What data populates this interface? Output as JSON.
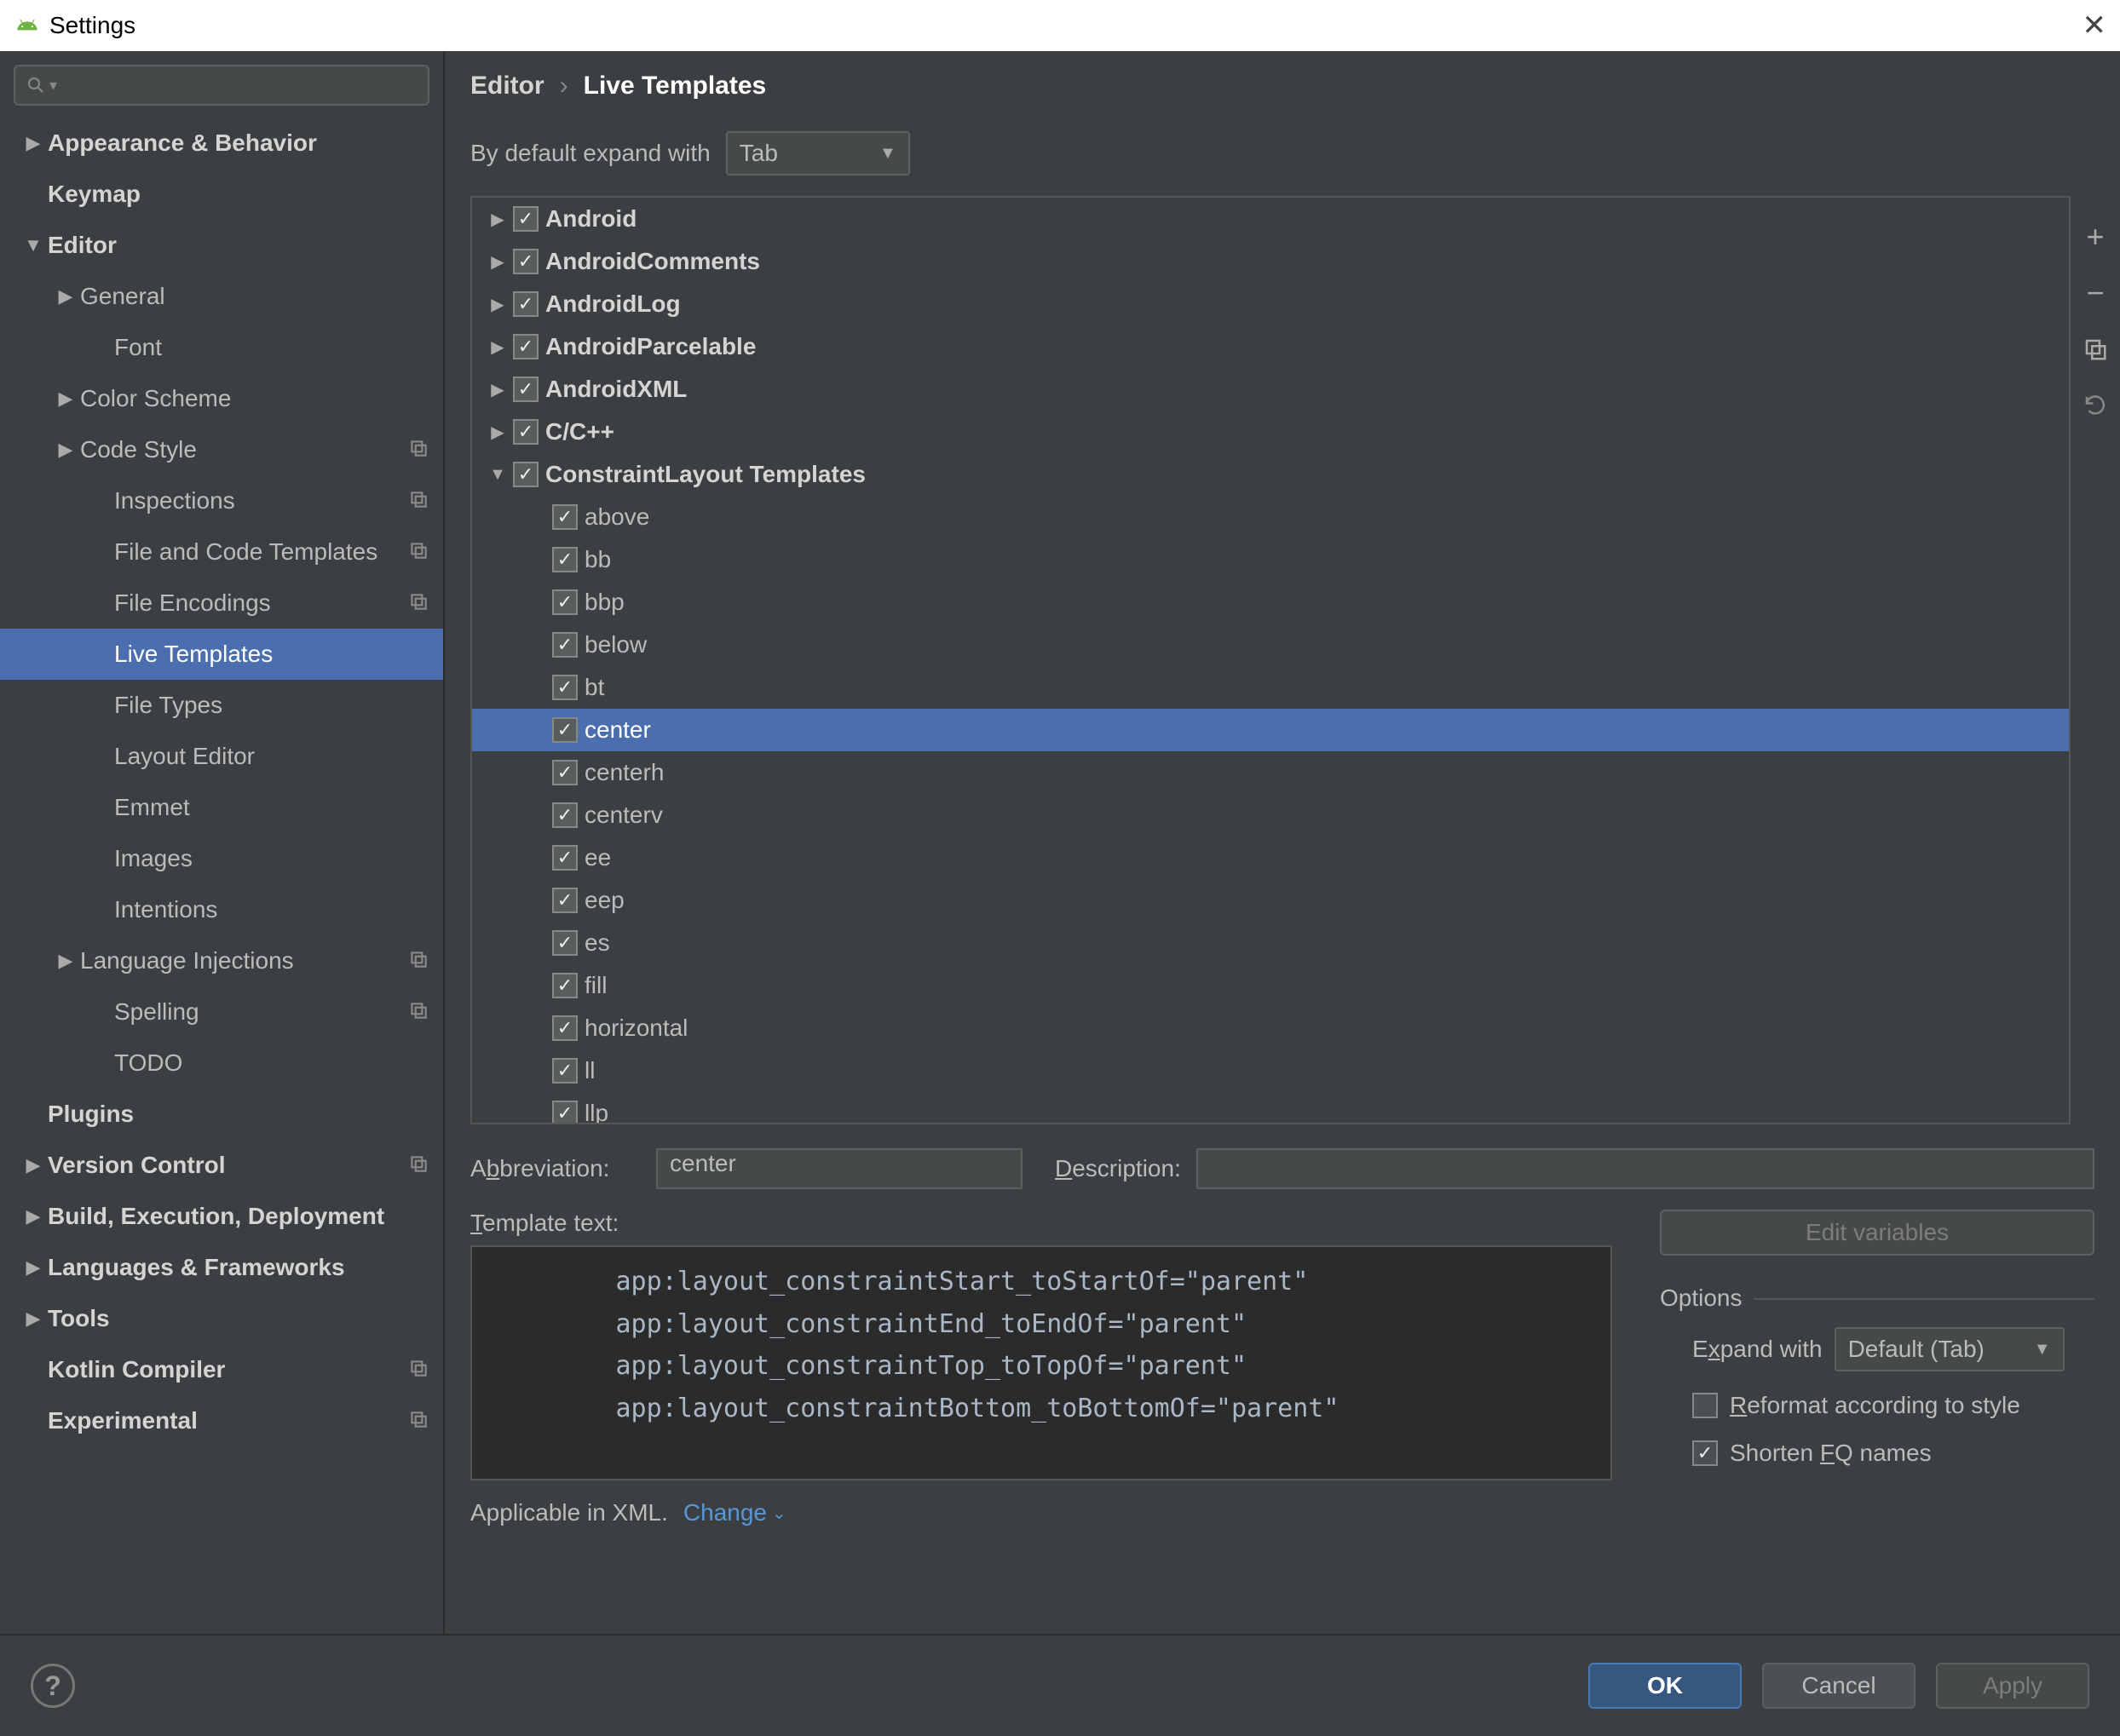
{
  "title": "Settings",
  "close_x": "✕",
  "searchPlaceholder": "",
  "sidebar": [
    {
      "arrow": "right",
      "label": "Appearance & Behavior",
      "indent": 1,
      "bold": true
    },
    {
      "arrow": "none",
      "label": "Keymap",
      "indent": 1,
      "bold": true
    },
    {
      "arrow": "down",
      "label": "Editor",
      "indent": 1,
      "bold": true
    },
    {
      "arrow": "right",
      "label": "General",
      "indent": 2
    },
    {
      "arrow": "none",
      "label": "Font",
      "indent": 3
    },
    {
      "arrow": "right",
      "label": "Color Scheme",
      "indent": 2
    },
    {
      "arrow": "right",
      "label": "Code Style",
      "indent": 2,
      "copy": true
    },
    {
      "arrow": "none",
      "label": "Inspections",
      "indent": 3,
      "copy": true
    },
    {
      "arrow": "none",
      "label": "File and Code Templates",
      "indent": 3,
      "copy": true
    },
    {
      "arrow": "none",
      "label": "File Encodings",
      "indent": 3,
      "copy": true
    },
    {
      "arrow": "none",
      "label": "Live Templates",
      "indent": 3,
      "selected": true
    },
    {
      "arrow": "none",
      "label": "File Types",
      "indent": 3
    },
    {
      "arrow": "none",
      "label": "Layout Editor",
      "indent": 3
    },
    {
      "arrow": "none",
      "label": "Emmet",
      "indent": 3
    },
    {
      "arrow": "none",
      "label": "Images",
      "indent": 3
    },
    {
      "arrow": "none",
      "label": "Intentions",
      "indent": 3
    },
    {
      "arrow": "right",
      "label": "Language Injections",
      "indent": 2,
      "copy": true
    },
    {
      "arrow": "none",
      "label": "Spelling",
      "indent": 3,
      "copy": true
    },
    {
      "arrow": "none",
      "label": "TODO",
      "indent": 3
    },
    {
      "arrow": "none",
      "label": "Plugins",
      "indent": 1,
      "bold": true
    },
    {
      "arrow": "right",
      "label": "Version Control",
      "indent": 1,
      "bold": true,
      "copy": true
    },
    {
      "arrow": "right",
      "label": "Build, Execution, Deployment",
      "indent": 1,
      "bold": true
    },
    {
      "arrow": "right",
      "label": "Languages & Frameworks",
      "indent": 1,
      "bold": true
    },
    {
      "arrow": "right",
      "label": "Tools",
      "indent": 1,
      "bold": true
    },
    {
      "arrow": "none",
      "label": "Kotlin Compiler",
      "indent": 1,
      "bold": true,
      "copy": true
    },
    {
      "arrow": "none",
      "label": "Experimental",
      "indent": 1,
      "bold": true,
      "copy": true
    }
  ],
  "breadcrumb": {
    "parent": "Editor",
    "sep": "›",
    "current": "Live Templates"
  },
  "expandWith": {
    "label": "By default expand with",
    "value": "Tab"
  },
  "groups": [
    {
      "arrow": "right",
      "label": "Android",
      "checked": true
    },
    {
      "arrow": "right",
      "label": "AndroidComments",
      "checked": true
    },
    {
      "arrow": "right",
      "label": "AndroidLog",
      "checked": true
    },
    {
      "arrow": "right",
      "label": "AndroidParcelable",
      "checked": true
    },
    {
      "arrow": "right",
      "label": "AndroidXML",
      "checked": true
    },
    {
      "arrow": "right",
      "label": "C/C++",
      "checked": true
    },
    {
      "arrow": "down",
      "label": "ConstraintLayout Templates",
      "checked": true,
      "children": [
        {
          "label": "above",
          "checked": true
        },
        {
          "label": "bb",
          "checked": true
        },
        {
          "label": "bbp",
          "checked": true
        },
        {
          "label": "below",
          "checked": true
        },
        {
          "label": "bt",
          "checked": true
        },
        {
          "label": "center",
          "checked": true,
          "selected": true
        },
        {
          "label": "centerh",
          "checked": true
        },
        {
          "label": "centerv",
          "checked": true
        },
        {
          "label": "ee",
          "checked": true
        },
        {
          "label": "eep",
          "checked": true
        },
        {
          "label": "es",
          "checked": true
        },
        {
          "label": "fill",
          "checked": true
        },
        {
          "label": "horizontal",
          "checked": true
        },
        {
          "label": "ll",
          "checked": true
        },
        {
          "label": "llp",
          "checked": true
        }
      ]
    }
  ],
  "toolbar": {
    "add": "+",
    "remove": "−",
    "duplicate": "⿻",
    "restore": "↶"
  },
  "detail": {
    "abbrevLabel": "Abbreviation:",
    "abbrevLabelPrefix": "A",
    "abbrevLabelHot": "b",
    "abbrevLabelSuffix": "breviation:",
    "abbrev": "center",
    "descLabelPrefix": "",
    "descLabelHot": "D",
    "descLabelSuffix": "escription:",
    "desc": "",
    "templateLabelPrefix": "",
    "templateLabelHot": "T",
    "templateLabelSuffix": "emplate text:",
    "templateText": "        app:layout_constraintStart_toStartOf=\"parent\"\n        app:layout_constraintEnd_toEndOf=\"parent\"\n        app:layout_constraintTop_toTopOf=\"parent\"\n        app:layout_constraintBottom_toBottomOf=\"parent\"",
    "editVariables": "Edit variables",
    "optionsTitle": "Options",
    "expandWithLabelPrefix": "E",
    "expandWithLabelHot": "x",
    "expandWithLabelSuffix": "pand with",
    "expandWithValue": "Default (Tab)",
    "reformatPrefix": "",
    "reformatHot": "R",
    "reformatSuffix": "eformat according to style",
    "shortenPrefix": "Shorten ",
    "shortenHot": "F",
    "shortenSuffix": "Q names",
    "reformatChecked": false,
    "shortenChecked": true
  },
  "applicable": {
    "text": "Applicable in XML.",
    "change": "Change"
  },
  "footer": {
    "help": "?",
    "ok": "OK",
    "cancel": "Cancel",
    "apply": "Apply"
  }
}
